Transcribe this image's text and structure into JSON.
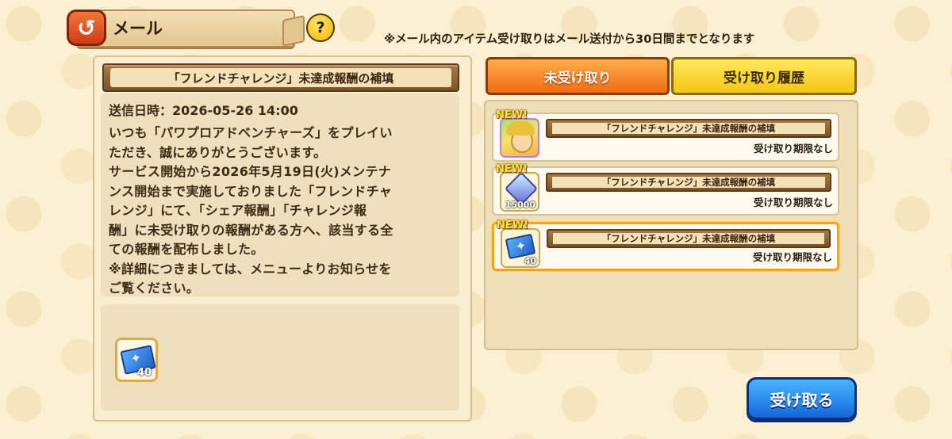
{
  "header": {
    "back_icon": "back-arrow-icon",
    "title": "メール",
    "help_label": "?",
    "notice": "※メール内のアイテム受け取りはメール送付から30日間までとなります"
  },
  "message": {
    "title": "「フレンドチャレンジ」未達成報酬の補填",
    "date": "送信日時：2026-05-26 14:00",
    "body": "いつも「パワプロアドベンチャーズ」をプレイい\nただき、誠にありがとうございます。\nサービス開始から2026年5月19日(火)メンテナ\nンス開始まで実施しておりました「フレンドチャ\nレンジ」にて、「シェア報酬」「チャレンジ報\n酬」に未受け取りの報酬がある方へ、該当する全\nての報酬を配布しました。\n※詳細につきましては、メニューよりお知らせを\nご覧ください。",
    "attachment": {
      "icon": "ticket-icon",
      "count": "40"
    }
  },
  "tabs": [
    {
      "label": "未受け取り",
      "active": true
    },
    {
      "label": "受け取り履歴",
      "active": false
    }
  ],
  "mail_list": [
    {
      "new_badge": "NEW!",
      "icon": "character-portrait-icon",
      "count": "",
      "title": "「フレンドチャレンジ」未達成報酬の補填",
      "expire": "受け取り期限なし",
      "selected": false
    },
    {
      "new_badge": "NEW!",
      "icon": "gem-icon",
      "count": "15000",
      "title": "「フレンドチャレンジ」未達成報酬の補填",
      "expire": "受け取り期限なし",
      "selected": false
    },
    {
      "new_badge": "NEW!",
      "icon": "ticket-icon",
      "count": "40",
      "title": "「フレンドチャレンジ」未達成報酬の補填",
      "expire": "受け取り期限なし",
      "selected": true
    }
  ],
  "receive_button": "受け取る",
  "colors": {
    "background": "#fbf0d2",
    "tab_active": "#f06d14",
    "tab_inactive": "#f5c615",
    "receive_button": "#1467d9",
    "selected_border": "#f3a514"
  }
}
